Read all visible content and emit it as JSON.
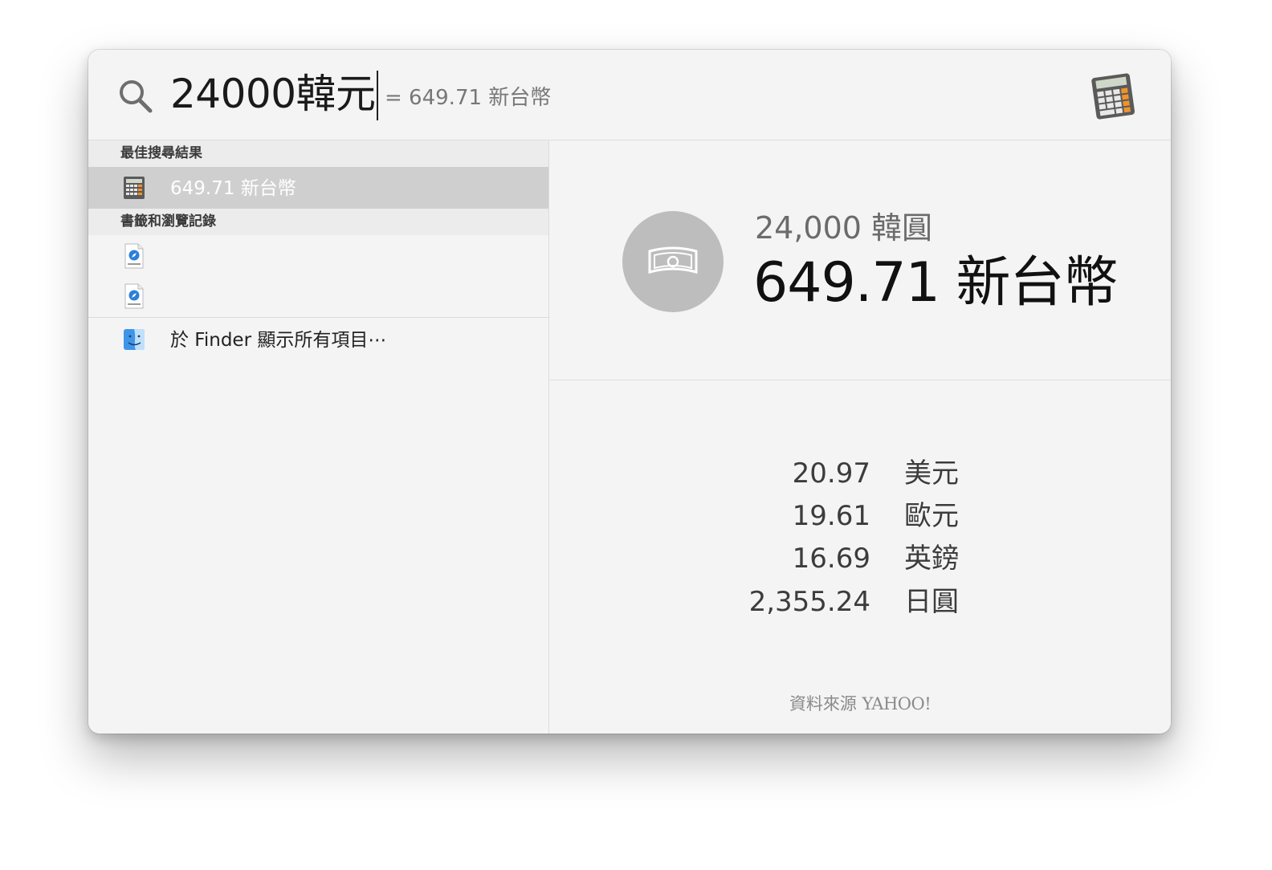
{
  "search": {
    "query": "24000韓元",
    "inline_result": "= 649.71 新台幣"
  },
  "results": {
    "sections": [
      {
        "header": "最佳搜尋結果"
      },
      {
        "header": "書籤和瀏覽記錄"
      }
    ],
    "top_hit": {
      "label": "649.71 新台幣",
      "icon": "calculator-icon"
    },
    "bookmarks": [
      {
        "label": "",
        "icon": "webloc-icon"
      },
      {
        "label": "",
        "icon": "webloc-icon"
      }
    ],
    "show_all": {
      "label": "於 Finder 顯示所有項目⋯",
      "icon": "finder-icon"
    }
  },
  "preview": {
    "source_amount": "24,000 韓圓",
    "result_amount": "649.71 新台幣",
    "conversions": [
      {
        "value": "20.97",
        "currency": "美元"
      },
      {
        "value": "19.61",
        "currency": "歐元"
      },
      {
        "value": "16.69",
        "currency": "英鎊"
      },
      {
        "value": "2,355.24",
        "currency": "日圓"
      }
    ],
    "data_source_label": "資料來源",
    "data_source_brand": "YAHOO!"
  },
  "colors": {
    "selection": "#cfcfcf",
    "background": "#f4f4f4"
  }
}
